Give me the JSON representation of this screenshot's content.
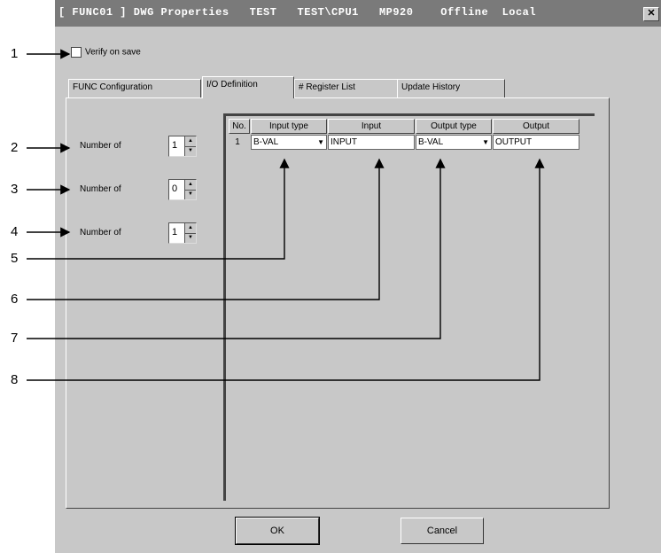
{
  "window": {
    "title": "[ FUNC01 ] DWG Properties   TEST   TEST\\CPU1   MP920    Offline  Local",
    "close_glyph": "✕"
  },
  "verify": {
    "label": "Verify on save",
    "checked": false
  },
  "tabs": [
    {
      "label": "FUNC Configuration",
      "active": false
    },
    {
      "label": "I/O Definition",
      "active": true
    },
    {
      "label": "# Register List",
      "active": false
    },
    {
      "label": "Update History",
      "active": false
    }
  ],
  "number_rows": [
    {
      "label": "Number of",
      "value": "1"
    },
    {
      "label": "Number of",
      "value": "0"
    },
    {
      "label": "Number of",
      "value": "1"
    }
  ],
  "grid": {
    "headers": [
      "No.",
      "Input type",
      "Input",
      "Output type",
      "Output"
    ],
    "rows": [
      {
        "no": "1",
        "input_type": "B-VAL",
        "input": "INPUT",
        "output_type": "B-VAL",
        "output": "OUTPUT"
      }
    ]
  },
  "buttons": {
    "ok": "OK",
    "cancel": "Cancel"
  },
  "callouts": [
    "1",
    "2",
    "3",
    "4",
    "5",
    "6",
    "7",
    "8"
  ]
}
